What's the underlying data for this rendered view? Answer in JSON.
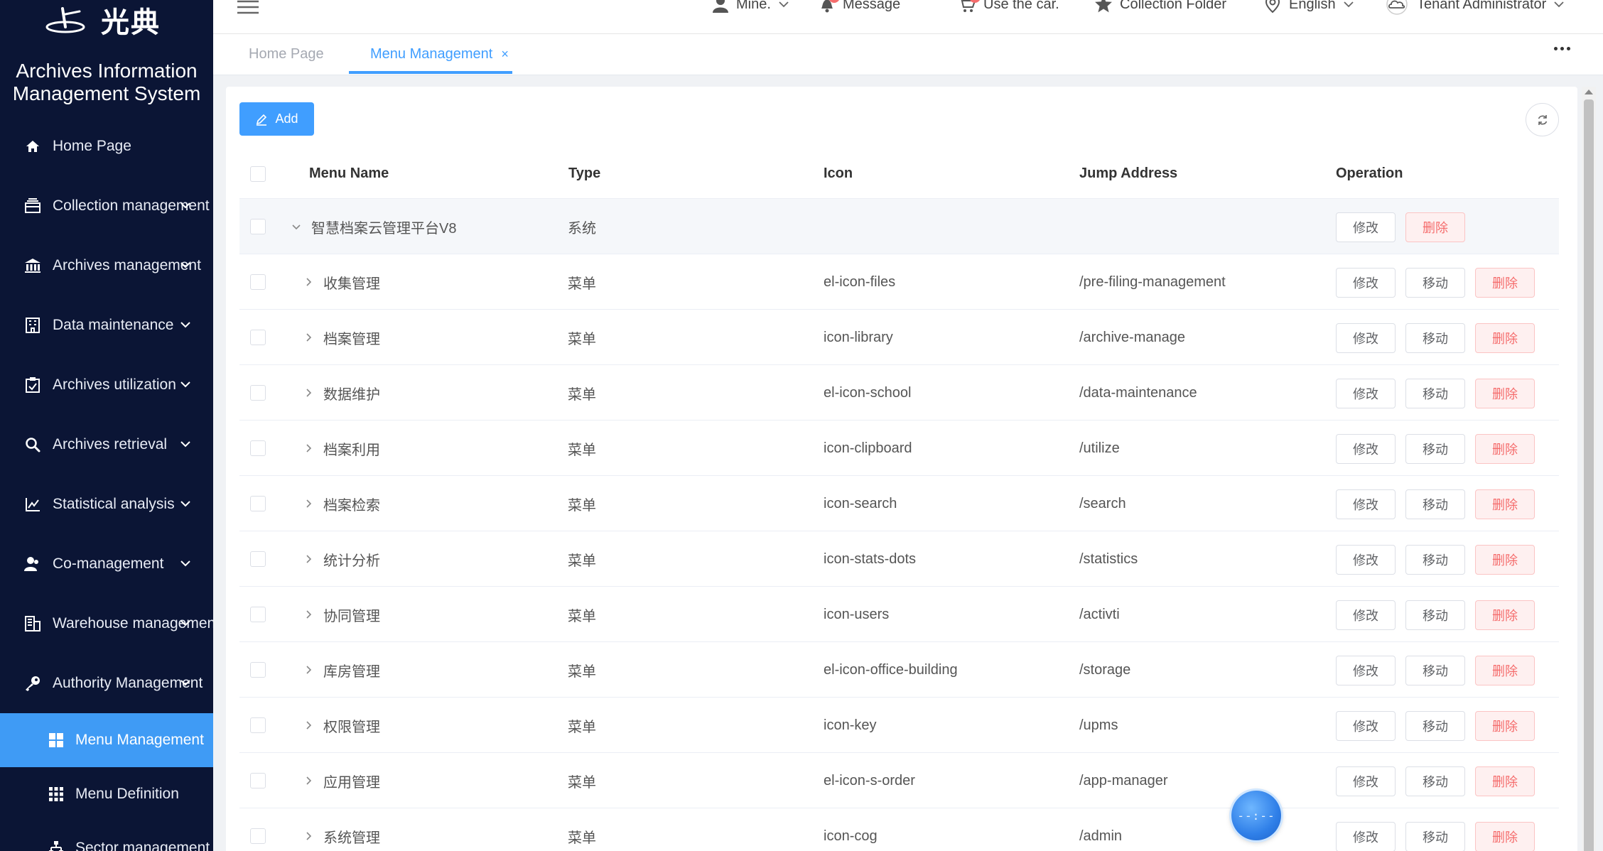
{
  "app": {
    "logo_text": "光典",
    "system_title_line1": "Archives Information",
    "system_title_line2": "Management System"
  },
  "sidebar": {
    "items": [
      {
        "label": "Home Page",
        "icon": "home-icon",
        "has_arrow": false
      },
      {
        "label": "Collection management",
        "icon": "files-icon",
        "has_arrow": true
      },
      {
        "label": "Archives management",
        "icon": "library-icon",
        "has_arrow": true
      },
      {
        "label": "Data maintenance",
        "icon": "building-icon",
        "has_arrow": true
      },
      {
        "label": "Archives utilization",
        "icon": "clipboard-icon",
        "has_arrow": true
      },
      {
        "label": "Archives retrieval",
        "icon": "search-icon",
        "has_arrow": true
      },
      {
        "label": "Statistical analysis",
        "icon": "chart-icon",
        "has_arrow": true
      },
      {
        "label": "Co-management",
        "icon": "users-icon",
        "has_arrow": true
      },
      {
        "label": "Warehouse management",
        "icon": "office-building-icon",
        "has_arrow": true
      },
      {
        "label": "Authority Management",
        "icon": "key-icon",
        "has_arrow": true
      }
    ],
    "sub_items": [
      {
        "label": "Menu Management",
        "icon": "grid-icon",
        "active": true
      },
      {
        "label": "Menu Definition",
        "icon": "grid-small-icon",
        "active": false
      },
      {
        "label": "Sector management",
        "icon": "sitemap-icon",
        "active": false
      }
    ]
  },
  "header": {
    "mine": "Mine.",
    "message": "Message",
    "cart": "Use the car.",
    "collection": "Collection Folder",
    "language": "English",
    "user": "Tenant Administrator"
  },
  "tabs": {
    "home": "Home Page",
    "menu_management": "Menu Management"
  },
  "toolbar": {
    "add_label": "Add"
  },
  "table": {
    "columns": [
      "Menu Name",
      "Type",
      "Icon",
      "Jump Address",
      "Operation"
    ],
    "buttons": {
      "edit": "修改",
      "move": "移动",
      "delete": "删除"
    },
    "rows": [
      {
        "name": "智慧档案云管理平台V8",
        "type": "系统",
        "icon": "",
        "address": "",
        "expanded": true,
        "level": 0
      },
      {
        "name": "收集管理",
        "type": "菜单",
        "icon": "el-icon-files",
        "address": "/pre-filing-management",
        "expanded": false,
        "level": 1
      },
      {
        "name": "档案管理",
        "type": "菜单",
        "icon": "icon-library",
        "address": "/archive-manage",
        "expanded": false,
        "level": 1
      },
      {
        "name": "数据维护",
        "type": "菜单",
        "icon": "el-icon-school",
        "address": "/data-maintenance",
        "expanded": false,
        "level": 1
      },
      {
        "name": "档案利用",
        "type": "菜单",
        "icon": "icon-clipboard",
        "address": "/utilize",
        "expanded": false,
        "level": 1
      },
      {
        "name": "档案检索",
        "type": "菜单",
        "icon": "icon-search",
        "address": "/search",
        "expanded": false,
        "level": 1
      },
      {
        "name": "统计分析",
        "type": "菜单",
        "icon": "icon-stats-dots",
        "address": "/statistics",
        "expanded": false,
        "level": 1
      },
      {
        "name": "协同管理",
        "type": "菜单",
        "icon": "icon-users",
        "address": "/activti",
        "expanded": false,
        "level": 1
      },
      {
        "name": "库房管理",
        "type": "菜单",
        "icon": "el-icon-office-building",
        "address": "/storage",
        "expanded": false,
        "level": 1
      },
      {
        "name": "权限管理",
        "type": "菜单",
        "icon": "icon-key",
        "address": "/upms",
        "expanded": false,
        "level": 1
      },
      {
        "name": "应用管理",
        "type": "菜单",
        "icon": "el-icon-s-order",
        "address": "/app-manager",
        "expanded": false,
        "level": 1
      },
      {
        "name": "系统管理",
        "type": "菜单",
        "icon": "icon-cog",
        "address": "/admin",
        "expanded": false,
        "level": 1
      }
    ]
  },
  "float_widget": {
    "text": "--:--"
  },
  "colors": {
    "sidebar_bg": "#0b1535",
    "accent": "#409eff",
    "danger": "#f56c6c"
  }
}
